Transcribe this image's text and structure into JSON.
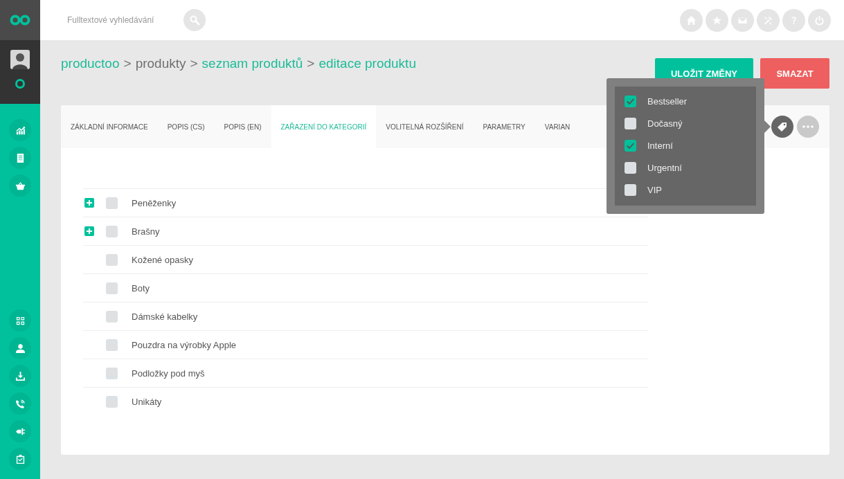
{
  "search": {
    "placeholder": "Fulltextové vyhledávání"
  },
  "breadcrumb": [
    {
      "label": "productoo",
      "kind": "link"
    },
    {
      "label": ">",
      "kind": "separator"
    },
    {
      "label": "produkty",
      "kind": "text"
    },
    {
      "label": ">",
      "kind": "separator"
    },
    {
      "label": "seznam produktů",
      "kind": "link"
    },
    {
      "label": ">",
      "kind": "separator"
    },
    {
      "label": "editace produktu",
      "kind": "link"
    }
  ],
  "actions": [
    {
      "label": "ULOŽIT ZMĚNY",
      "kind": "primary"
    },
    {
      "label": "SMAZAT",
      "kind": "danger"
    }
  ],
  "tabs": [
    {
      "label": "ZÁKLADNÍ INFORMACE",
      "selected": false
    },
    {
      "label": "POPIS (CS)",
      "selected": false
    },
    {
      "label": "POPIS (EN)",
      "selected": false
    },
    {
      "label": "ZAŘAZENÍ DO KATEGORIÍ",
      "selected": true
    },
    {
      "label": "VOLITELNÁ ROZŠÍŘENÍ",
      "selected": false
    },
    {
      "label": "PARAMETRY",
      "selected": false
    },
    {
      "label": "VARIAN",
      "selected": false
    }
  ],
  "categories": [
    {
      "label": "Peněženky",
      "expandable": true,
      "checked": false
    },
    {
      "label": "Brašny",
      "expandable": true,
      "checked": false
    },
    {
      "label": "Kožené opasky",
      "expandable": false,
      "checked": false
    },
    {
      "label": "Boty",
      "expandable": false,
      "checked": false
    },
    {
      "label": "Dámské kabelky",
      "expandable": false,
      "checked": false
    },
    {
      "label": "Pouzdra na výrobky Apple",
      "expandable": false,
      "checked": false
    },
    {
      "label": "Podložky pod myš",
      "expandable": false,
      "checked": false
    },
    {
      "label": "Unikáty",
      "expandable": false,
      "checked": false
    }
  ],
  "tag_menu": {
    "items": [
      {
        "label": "Bestseller",
        "checked": true
      },
      {
        "label": "Dočasný",
        "checked": false
      },
      {
        "label": "Interní",
        "checked": true
      },
      {
        "label": "Urgentní",
        "checked": false
      },
      {
        "label": "VIP",
        "checked": false
      }
    ]
  }
}
